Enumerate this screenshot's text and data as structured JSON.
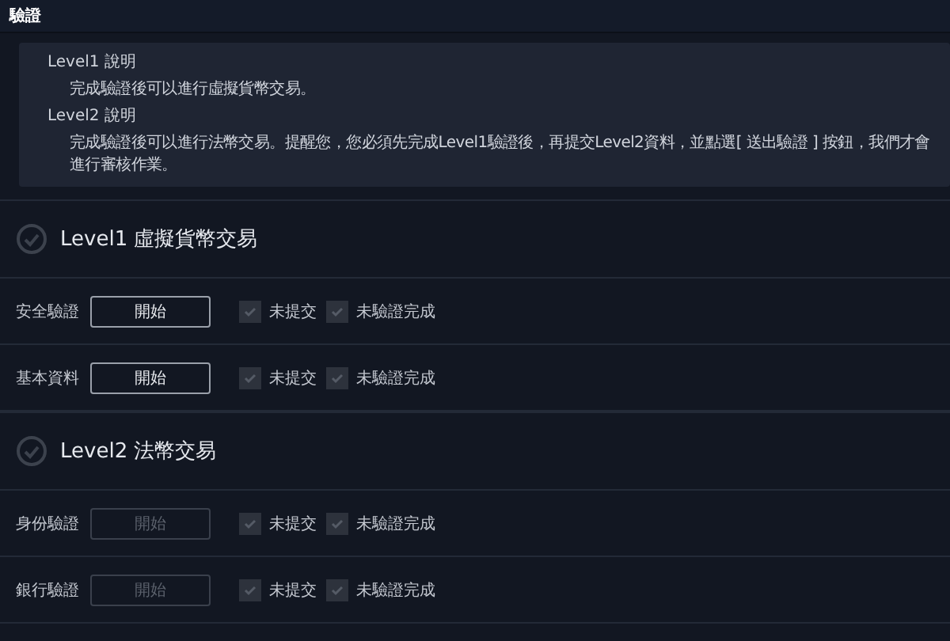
{
  "header": {
    "title": "驗證"
  },
  "info": [
    {
      "title": "Level1 說明",
      "text": "完成驗證後可以進行虛擬貨幣交易。"
    },
    {
      "title": "Level2 說明",
      "text": "完成驗證後可以進行法幣交易。提醒您，您必須先完成Level1驗證後，再提交Level2資料，並點選[ 送出驗證 ] 按鈕，我們才會進行審核作業。"
    }
  ],
  "sections": [
    {
      "title": "Level1 虛擬貨幣交易",
      "rows": [
        {
          "label": "安全驗證",
          "button": "開始",
          "disabled": false,
          "checks": [
            {
              "label": "未提交",
              "checked": false
            },
            {
              "label": "未驗證完成",
              "checked": false
            }
          ]
        },
        {
          "label": "基本資料",
          "button": "開始",
          "disabled": false,
          "checks": [
            {
              "label": "未提交",
              "checked": false
            },
            {
              "label": "未驗證完成",
              "checked": false
            }
          ]
        }
      ]
    },
    {
      "title": "Level2 法幣交易",
      "rows": [
        {
          "label": "身份驗證",
          "button": "開始",
          "disabled": true,
          "checks": [
            {
              "label": "未提交",
              "checked": false
            },
            {
              "label": "未驗證完成",
              "checked": false
            }
          ]
        },
        {
          "label": "銀行驗證",
          "button": "開始",
          "disabled": true,
          "checks": [
            {
              "label": "未提交",
              "checked": false
            },
            {
              "label": "未驗證完成",
              "checked": false
            }
          ]
        }
      ]
    }
  ]
}
